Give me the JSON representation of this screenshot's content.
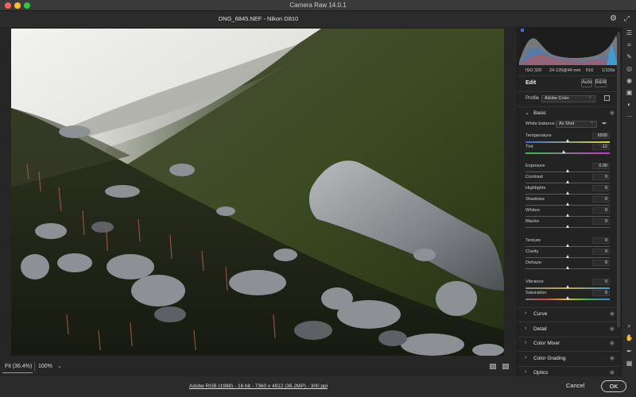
{
  "window": {
    "title": "Camera Raw 14.0.1"
  },
  "file": {
    "name_line": "DNG_6845.NEF  -  Nikon D810"
  },
  "camera_info": {
    "iso": "ISO 320",
    "lens": "24-120@44 mm",
    "aperture": "f/16",
    "shutter": "1/100s"
  },
  "edit": {
    "title": "Edit",
    "auto_label": "Auto",
    "bw_label": "B&W"
  },
  "profile": {
    "label": "Profile",
    "value": "Adobe Color"
  },
  "basic": {
    "label": "Basic",
    "white_balance_label": "White balance",
    "white_balance_value": "As Shot",
    "temperature": {
      "label": "Temperature",
      "value": "6500",
      "position": 0.5
    },
    "tint": {
      "label": "Tint",
      "value": "-12",
      "position": 0.46
    },
    "exposure": {
      "label": "Exposure",
      "value": "0.00",
      "position": 0.5
    },
    "contrast": {
      "label": "Contrast",
      "value": "0",
      "position": 0.5
    },
    "highlights": {
      "label": "Highlights",
      "value": "0",
      "position": 0.5
    },
    "shadows": {
      "label": "Shadows",
      "value": "0",
      "position": 0.5
    },
    "whites": {
      "label": "Whites",
      "value": "0",
      "position": 0.5
    },
    "blacks": {
      "label": "Blacks",
      "value": "0",
      "position": 0.5
    },
    "texture": {
      "label": "Texture",
      "value": "0",
      "position": 0.5
    },
    "clarity": {
      "label": "Clarity",
      "value": "0",
      "position": 0.5
    },
    "dehaze": {
      "label": "Dehaze",
      "value": "0",
      "position": 0.5
    },
    "vibrance": {
      "label": "Vibrance",
      "value": "0",
      "position": 0.5
    },
    "saturation": {
      "label": "Saturation",
      "value": "0",
      "position": 0.5
    }
  },
  "sections": {
    "curve": "Curve",
    "detail": "Detail",
    "color_mixer": "Color Mixer",
    "color_grading": "Color Grading",
    "optics": "Optics"
  },
  "zoom": {
    "fit_label": "Fit (36.4%)",
    "percent_label": "100%"
  },
  "footer": {
    "info": "Adobe RGB (1998) - 16 bit - 7360 x 4912 (36.2MP) - 300 ppi",
    "cancel_label": "Cancel",
    "ok_label": "OK"
  },
  "icons": [
    "gear-icon",
    "expand-icon",
    "edit-tool-icon",
    "crop-icon",
    "healing-icon",
    "mask-icon",
    "redeye-icon",
    "snapshot-icon",
    "presets-icon",
    "more-icon",
    "zoom-icon",
    "hand-icon",
    "sampler-icon",
    "grid-overlay-icon",
    "eye-icon",
    "eyedropper-icon",
    "chevron-down-icon",
    "chevron-right-icon"
  ],
  "colors": {
    "accent": "#e8e8e8",
    "panel_bg": "#232323",
    "close": "#ff5f57",
    "minimize": "#febc2e",
    "maximize": "#28c840"
  }
}
